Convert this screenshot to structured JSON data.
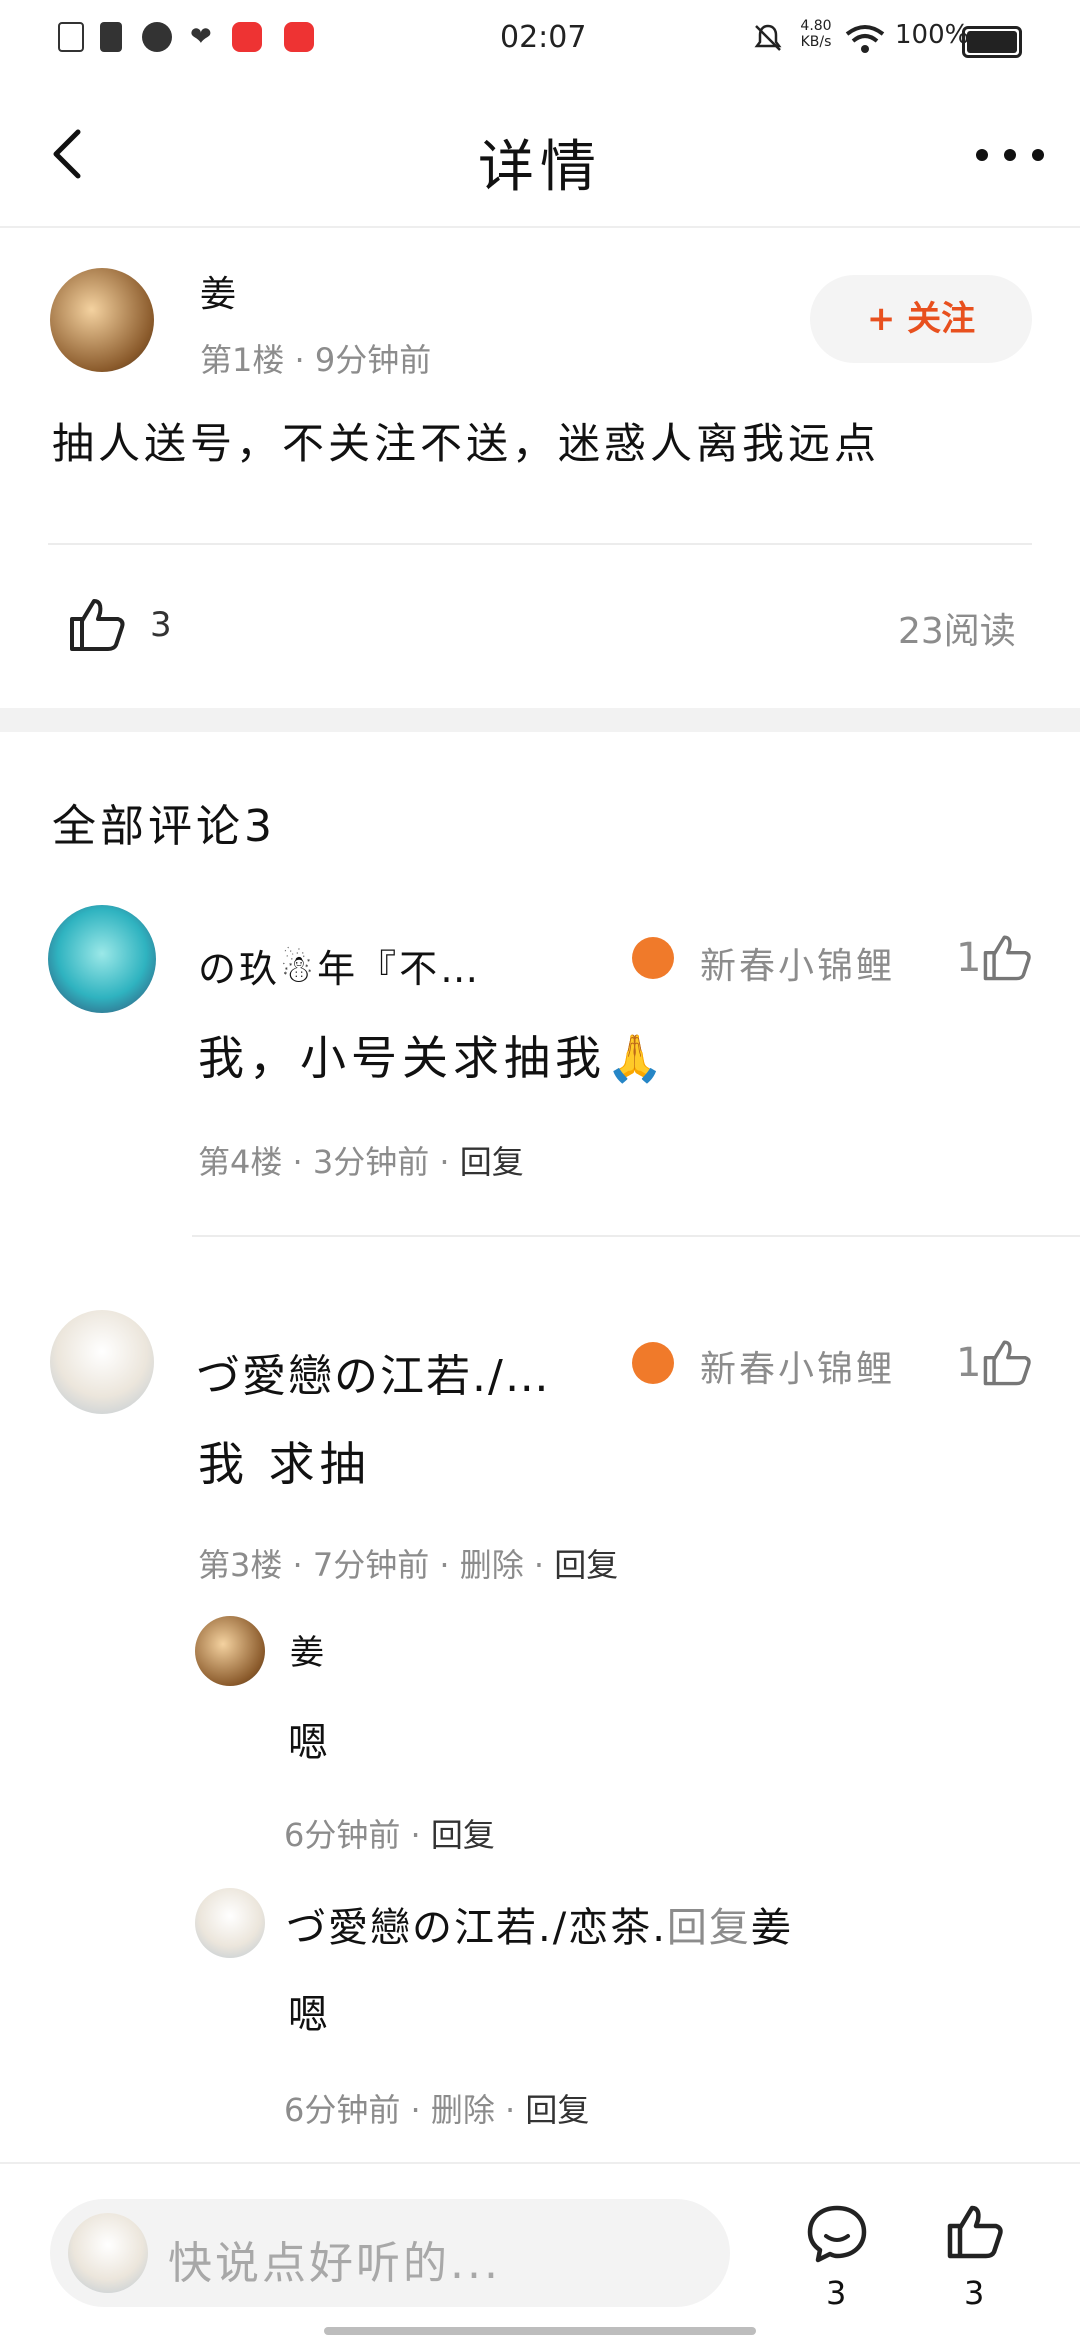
{
  "status_bar": {
    "time": "02:07",
    "speed_value": "4.80",
    "speed_unit": "KB/s",
    "battery": "100%"
  },
  "nav": {
    "title": "详情"
  },
  "post": {
    "author": "姜",
    "meta": "第1楼 · 9分钟前",
    "follow_label": "+ 关注",
    "content": "抽人送号，不关注不送，迷惑人离我远点",
    "like_count": "3",
    "reads": "23阅读"
  },
  "comments_header": "全部评论3",
  "comments": [
    {
      "name": "の玖☃年『不…",
      "badge": "新春小锦鲤",
      "likes": "1",
      "text": "我，小号关求抽我🙏",
      "meta_prefix": "第4楼 · 3分钟前 · ",
      "reply": "回复"
    },
    {
      "name": "づ愛戀の江若./…",
      "badge": "新春小锦鲤",
      "likes": "1",
      "text": "我 求抽",
      "meta_prefix": "第3楼 · 7分钟前 · 删除 · ",
      "reply": "回复",
      "replies": [
        {
          "name": "姜",
          "text": "嗯",
          "meta_prefix": "6分钟前 · ",
          "reply": "回复"
        },
        {
          "name": "づ愛戀の江若./恋茶.",
          "reply_word": "回复",
          "reply_to": "姜",
          "text": "嗯",
          "meta_prefix": "6分钟前 · 删除 · ",
          "reply": "回复"
        }
      ]
    }
  ],
  "bottom_bar": {
    "placeholder": "快说点好听的...",
    "comment_count": "3",
    "like_count": "3"
  },
  "colors": {
    "accent": "#e8501e",
    "badge": "#f07a2a",
    "muted": "#8c8c8c"
  }
}
